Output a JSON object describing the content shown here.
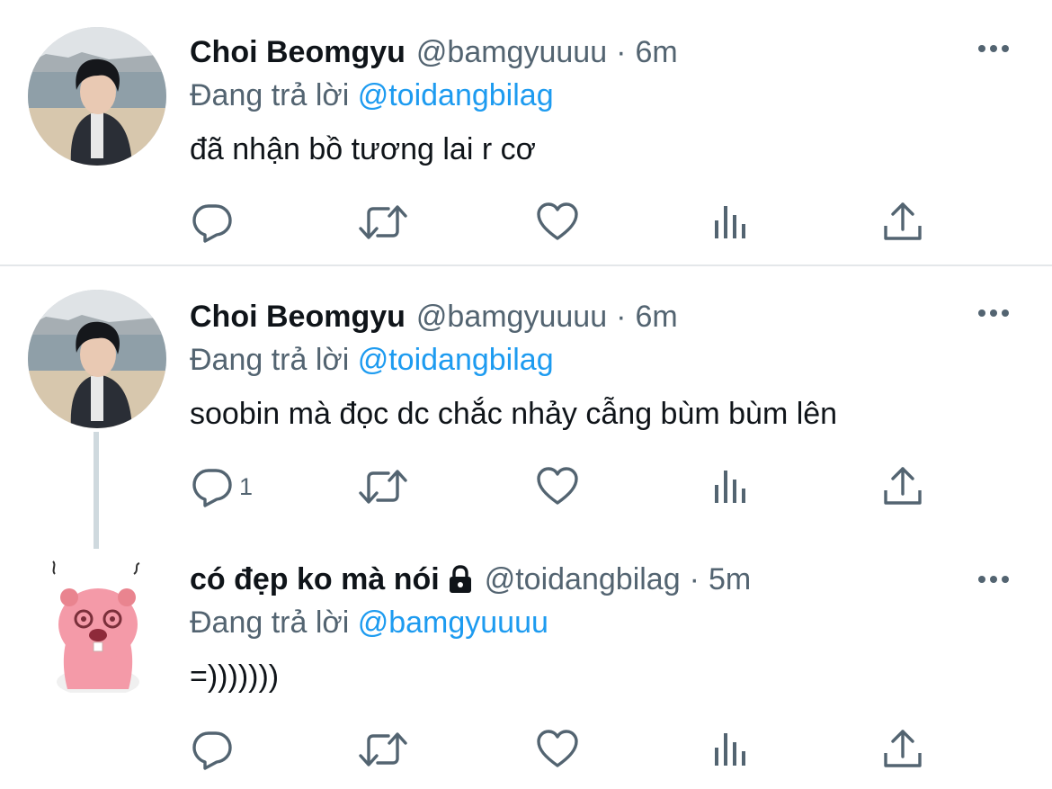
{
  "tweets": [
    {
      "name": "Choi Beomgyu",
      "handle": "@bamgyuuuu",
      "separator": "·",
      "time": "6m",
      "replying_prefix": "Đang trả lời ",
      "replying_to": "@toidangbilag",
      "text": "đã nhận bồ tương lai r cơ",
      "reply_count": "",
      "avatar": "person-photo-avatar"
    },
    {
      "name": "Choi Beomgyu",
      "handle": "@bamgyuuuu",
      "separator": "·",
      "time": "6m",
      "replying_prefix": "Đang trả lời ",
      "replying_to": "@toidangbilag",
      "text": "soobin mà đọc dc chắc nhảy cẫng bùm bùm lên",
      "reply_count": "1",
      "avatar": "person-photo-avatar"
    },
    {
      "name": "có đẹp ko mà nói",
      "handle": "@toidangbilag",
      "separator": "·",
      "time": "5m",
      "replying_prefix": "Đang trả lời ",
      "replying_to": "@bamgyuuuu",
      "text": "=)))))))",
      "reply_count": "",
      "avatar": "pink-beaver-avatar",
      "protected": true
    }
  ],
  "icons": {
    "reply": "reply-icon",
    "retweet": "retweet-icon",
    "like": "heart-icon",
    "views": "views-icon",
    "share": "share-icon",
    "more": "more-icon",
    "lock": "lock-icon"
  },
  "colors": {
    "mention": "#1d9bf0",
    "secondary_text": "#536471",
    "primary_text": "#0f1419",
    "divider": "#e4e7ea",
    "thread_line": "#cfd9de"
  }
}
